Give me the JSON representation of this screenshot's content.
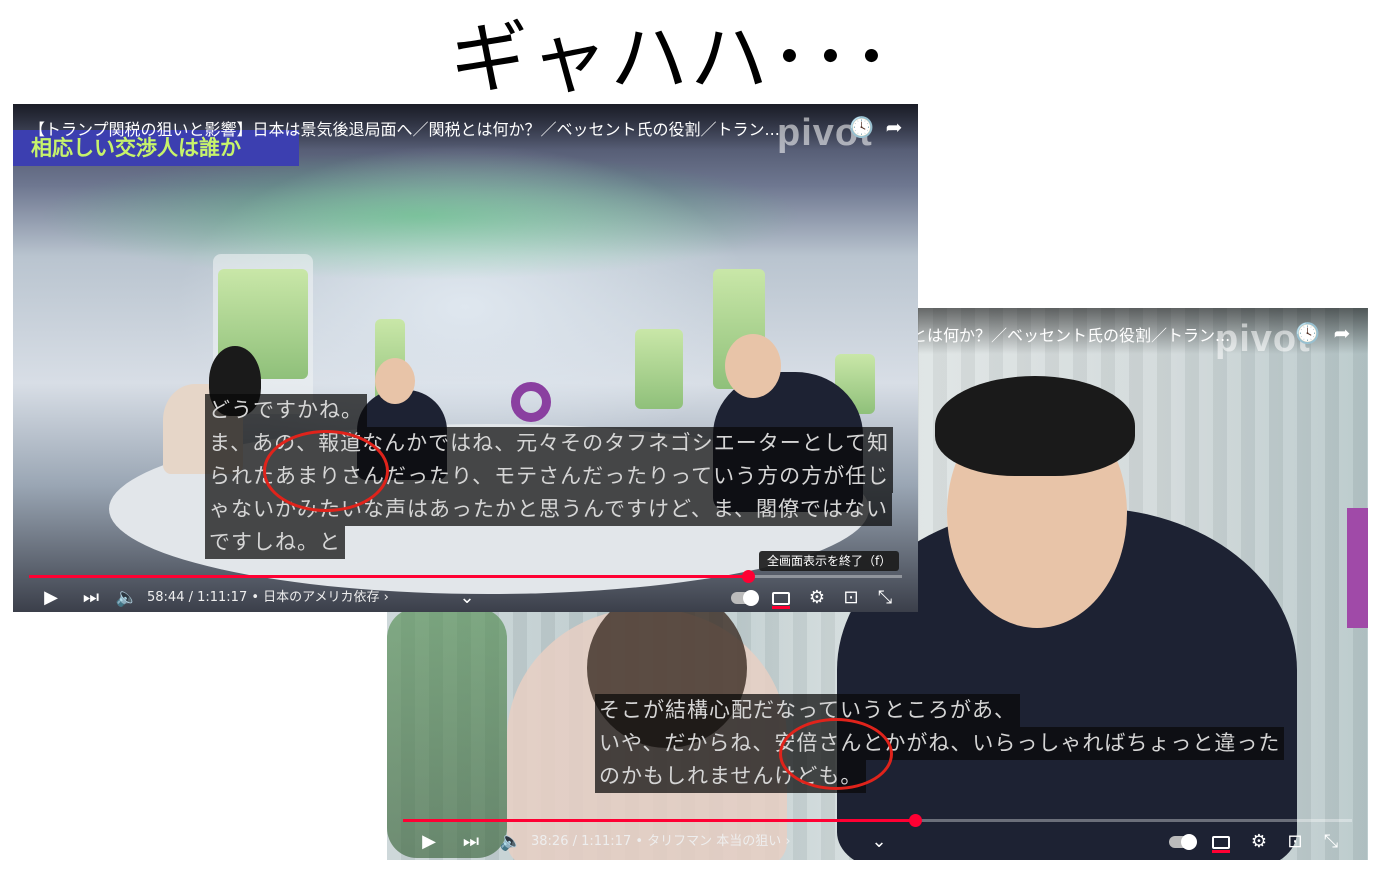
{
  "headline": "ギャハハ･･･",
  "players": [
    {
      "title": "【トランプ関税の狙いと影響】日本は景気後退局面へ／関税とは何か？／ベッセント氏の役割／トラン...",
      "lower_third": "相応しい交渉人は誰か",
      "logo": "pivot",
      "captions": [
        "どうですかね。",
        "ま、あの、報道なんかではね、元々そのタフネゴシエーターとして知",
        "られたあまりさんだったり、モテさんだったりっていう方の方が任じ",
        "ゃないかみたいな声はあったかと思うんですけど、ま、閣僚ではない",
        "ですしね。と"
      ],
      "time": "58:44 / 1:11:17 • 日本のアメリカ依存 ›",
      "tooltip": "全画面表示を終了（f）",
      "progress": 0.824
    },
    {
      "title": "とは何か？／ベッセント氏の役割／トラン...",
      "logo": "pivot",
      "captions": [
        "そこが結構心配だなっていうところがあ、",
        "いや、だからね、安倍さんとかがね、いらっしゃればちょっと違った",
        "のかもしれませんけども。"
      ],
      "time": "38:26 / 1:11:17 • タリフマン 本当の狙い ›",
      "progress": 0.54
    }
  ],
  "icons": {
    "play": "▶",
    "next": "⏭",
    "volume": "🔈",
    "chevron": "⌄",
    "settings": "⚙",
    "cast": "⊡",
    "exit_fullscreen": "⤡",
    "clock": "🕓",
    "share": "➦"
  },
  "colors": {
    "accent": "#ff0033",
    "annotation": "#e0231b",
    "lower_third_bg": "#3c3fb0",
    "lower_third_text": "#c7f36b"
  }
}
